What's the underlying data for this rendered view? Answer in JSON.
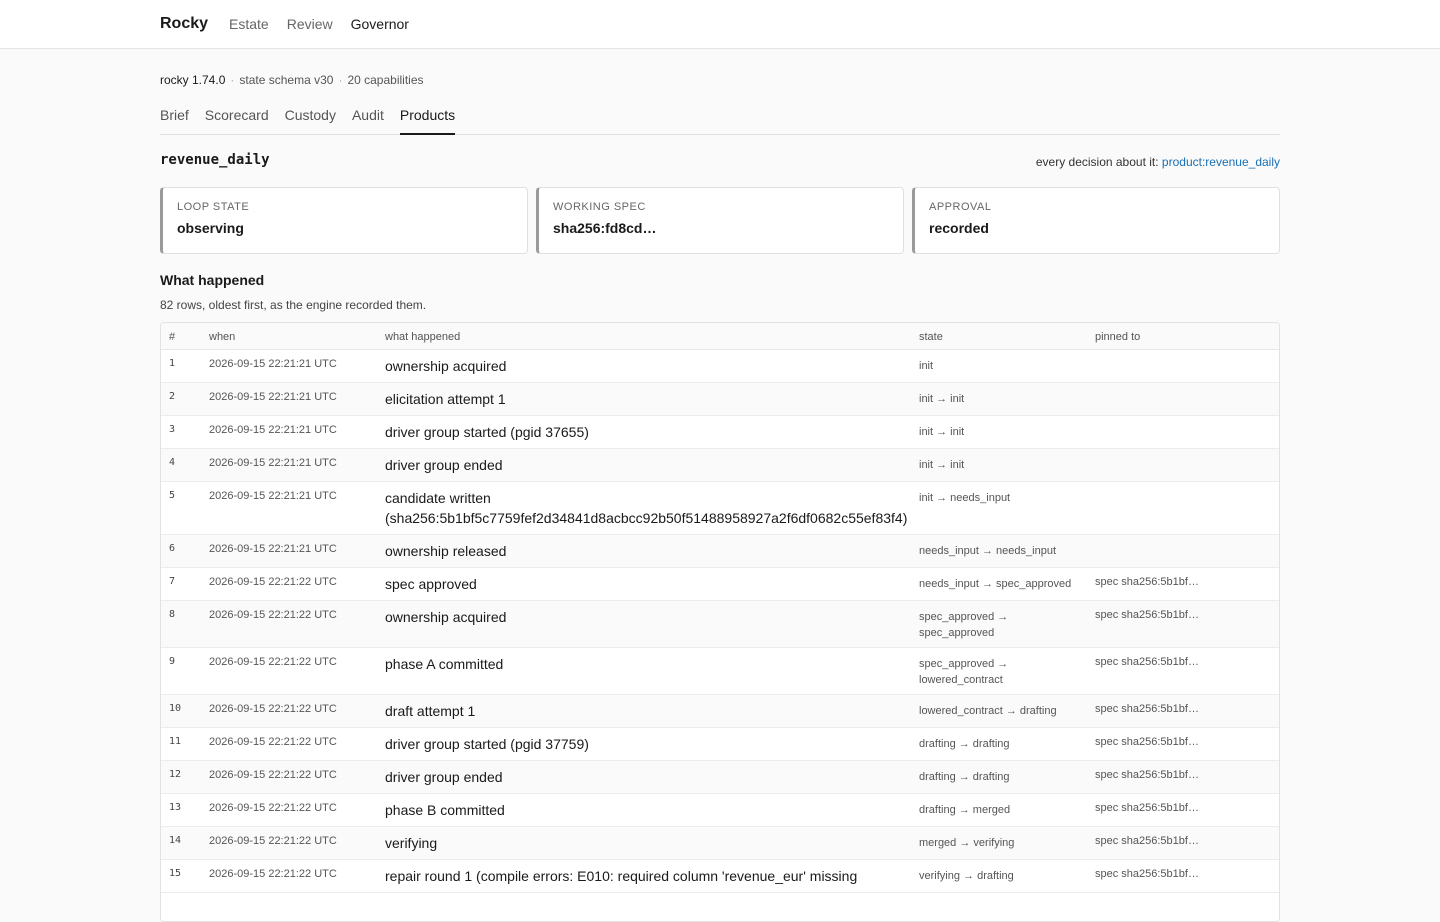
{
  "topbar": {
    "brand": "Rocky",
    "nav": [
      "Estate",
      "Review",
      "Governor"
    ],
    "active_nav": "Governor"
  },
  "meta": {
    "version": "rocky 1.74.0",
    "schema": "state schema v30",
    "capabilities": "20 capabilities"
  },
  "tabs": [
    "Brief",
    "Scorecard",
    "Custody",
    "Audit",
    "Products"
  ],
  "active_tab": "Products",
  "product": {
    "name": "revenue_daily",
    "decision_prefix": "every decision about it: ",
    "decision_link": "product:revenue_daily"
  },
  "cards": [
    {
      "label": "LOOP STATE",
      "value": "observing"
    },
    {
      "label": "WORKING SPEC",
      "value": "sha256:fd8cd…"
    },
    {
      "label": "APPROVAL",
      "value": "recorded"
    }
  ],
  "history": {
    "title": "What happened",
    "subtitle": "82 rows, oldest first, as the engine recorded them.",
    "columns": [
      "#",
      "when",
      "what happened",
      "state",
      "pinned to"
    ],
    "rows": [
      {
        "n": "1",
        "when": "2026-09-15 22:21:21 UTC",
        "what": "ownership acquired",
        "state": "init",
        "pin": ""
      },
      {
        "n": "2",
        "when": "2026-09-15 22:21:21 UTC",
        "what": "elicitation attempt 1",
        "state": "init → init",
        "pin": ""
      },
      {
        "n": "3",
        "when": "2026-09-15 22:21:21 UTC",
        "what": "driver group started (pgid 37655)",
        "state": "init → init",
        "pin": ""
      },
      {
        "n": "4",
        "when": "2026-09-15 22:21:21 UTC",
        "what": "driver group ended",
        "state": "init → init",
        "pin": ""
      },
      {
        "n": "5",
        "when": "2026-09-15 22:21:21 UTC",
        "what": "candidate written (sha256:5b1bf5c7759fef2d34841d8acbcc92b50f51488958927a2f6df0682c55ef83f4)",
        "state": "init → needs_input",
        "pin": ""
      },
      {
        "n": "6",
        "when": "2026-09-15 22:21:21 UTC",
        "what": "ownership released",
        "state": "needs_input → needs_input",
        "pin": ""
      },
      {
        "n": "7",
        "when": "2026-09-15 22:21:22 UTC",
        "what": "spec approved",
        "state": "needs_input → spec_approved",
        "pin": "spec sha256:5b1bf…"
      },
      {
        "n": "8",
        "when": "2026-09-15 22:21:22 UTC",
        "what": "ownership acquired",
        "state": "spec_approved → spec_approved",
        "pin": "spec sha256:5b1bf…"
      },
      {
        "n": "9",
        "when": "2026-09-15 22:21:22 UTC",
        "what": "phase A committed",
        "state": "spec_approved → lowered_contract",
        "pin": "spec sha256:5b1bf…"
      },
      {
        "n": "10",
        "when": "2026-09-15 22:21:22 UTC",
        "what": "draft attempt 1",
        "state": "lowered_contract → drafting",
        "pin": "spec sha256:5b1bf…"
      },
      {
        "n": "11",
        "when": "2026-09-15 22:21:22 UTC",
        "what": "driver group started (pgid 37759)",
        "state": "drafting → drafting",
        "pin": "spec sha256:5b1bf…"
      },
      {
        "n": "12",
        "when": "2026-09-15 22:21:22 UTC",
        "what": "driver group ended",
        "state": "drafting → drafting",
        "pin": "spec sha256:5b1bf…"
      },
      {
        "n": "13",
        "when": "2026-09-15 22:21:22 UTC",
        "what": "phase B committed",
        "state": "drafting → merged",
        "pin": "spec sha256:5b1bf…"
      },
      {
        "n": "14",
        "when": "2026-09-15 22:21:22 UTC",
        "what": "verifying",
        "state": "merged → verifying",
        "pin": "spec sha256:5b1bf…"
      },
      {
        "n": "15",
        "when": "2026-09-15 22:21:22 UTC",
        "what": "repair round 1 (compile errors: E010: required column 'revenue_eur' missing",
        "state": "verifying → drafting",
        "pin": "spec sha256:5b1bf…"
      }
    ]
  }
}
